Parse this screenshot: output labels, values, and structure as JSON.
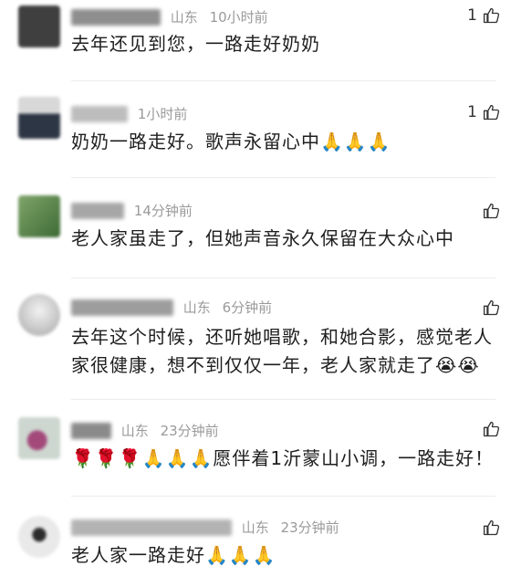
{
  "comments": [
    {
      "location": "山东",
      "time": "10小时前",
      "text": "去年还见到您，一路走好奶奶",
      "likes": "1",
      "avatar_color": "#4a4a4a"
    },
    {
      "location": "",
      "time": "1小时前",
      "text": "奶奶一路走好。歌声永留心中🙏🙏🙏",
      "likes": "1",
      "avatar_color": "#6b6f74"
    },
    {
      "location": "",
      "time": "14分钟前",
      "text": "老人家虽走了，但她声音永久保留在大众心中",
      "likes": "",
      "avatar_color": "#5f8a4e"
    },
    {
      "location": "山东",
      "time": "6分钟前",
      "text": "去年这个时候，还听她唱歌，和她合影，感觉老人家很健康，想不到仅仅一年，老人家就走了😭😭",
      "likes": "",
      "avatar_color": "#c9c9c9"
    },
    {
      "location": "山东",
      "time": "23分钟前",
      "text": "🌹🌹🌹🙏🙏🙏愿伴着1沂蒙山小调，一路走好！",
      "likes": "",
      "avatar_color": "#9a7aa8"
    },
    {
      "location": "山东",
      "time": "23分钟前",
      "text": "老人家一路走好🙏🙏🙏",
      "likes": "",
      "avatar_color": "#b9b9b9"
    }
  ]
}
